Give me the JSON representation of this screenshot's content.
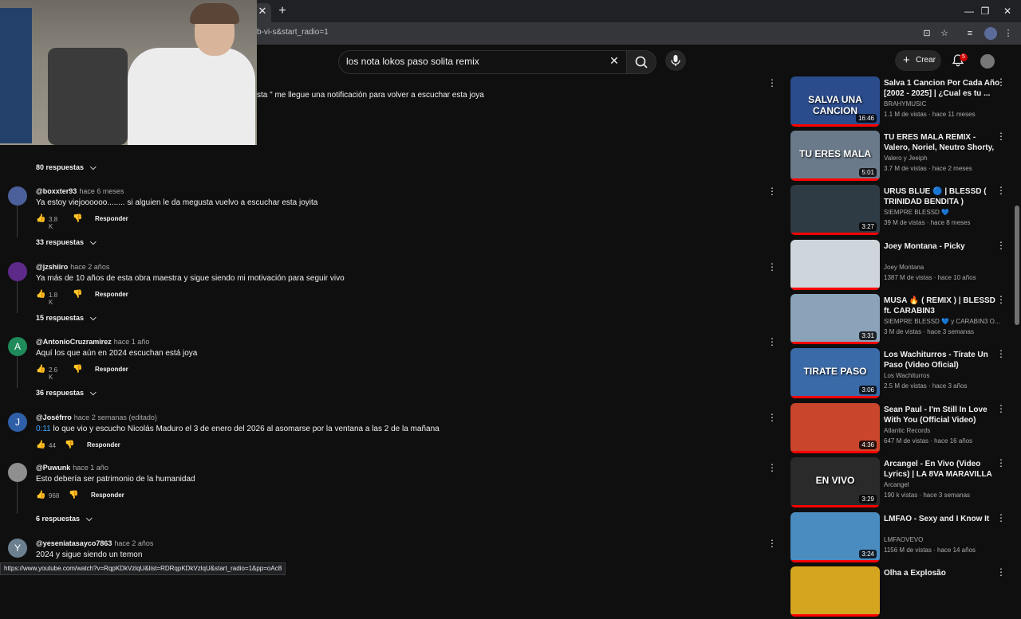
{
  "browser": {
    "url": "b-vi-s&start_radio=1",
    "status_url": "https://www.youtube.com/watch?v=RqpKDkVzlqU&list=RDRqpKDkVzlqU&start_radio=1&pp=oAc8"
  },
  "header": {
    "search_value": "los nota lokos paso solita remix",
    "create_label": "Crear",
    "notification_count": "5"
  },
  "comments": [
    {
      "author": "",
      "time": "",
      "text": "sta \" me llegue una notificación para volver a escuchar esta joya",
      "likes": "",
      "replies": "80 respuestas"
    },
    {
      "author": "@boxxter93",
      "time": "hace 6 meses",
      "text": "Ya estoy viejoooooo........ si alguien le da megusta vuelvo a escuchar esta joyita",
      "likes": "3.8 K",
      "replies": "33 respuestas"
    },
    {
      "author": "@jzshiiro",
      "time": "hace 2 años",
      "text": "Ya más de 10 años de esta obra maestra y sigue siendo mi motivación para seguir vivo",
      "likes": "1.8 K",
      "replies": "15 respuestas"
    },
    {
      "author": "@AntonioCruzramirez",
      "time": "hace 1 año",
      "text": "Aquí los que aún en 2024 escuchan está joya",
      "likes": "2.6 K",
      "replies": "36 respuestas",
      "avatar_letter": "A"
    },
    {
      "author": "@Joséfrro",
      "time": "hace 2 semanas (editado)",
      "timestamp_link": "0:11",
      "text": " lo que vio y escucho Nicolás Maduro el 3 de enero del 2026 al asomarse por la ventana a las 2 de la mañana",
      "likes": "44",
      "replies": "",
      "avatar_letter": "J"
    },
    {
      "author": "@Puwunk",
      "time": "hace 1 año",
      "text": "Esto debería ser patrimonio de la humanidad",
      "likes": "968",
      "replies": "6 respuestas"
    },
    {
      "author": "@yeseniatasayco7863",
      "time": "hace 2 años",
      "text": "2024 y sigue siendo un temon",
      "likes": "",
      "replies": "",
      "avatar_letter": "Y"
    }
  ],
  "reply_label": "Responder",
  "related": [
    {
      "title": "Salva 1 Cancion Por Cada Año [2002 - 2025] | ¿Cual es tu ...",
      "channel": "BRAHYMUSIC",
      "meta": "1.1 M de vistas · hace 11 meses",
      "duration": "16:46",
      "thumb_text": "SALVA UNA CANCION",
      "color": "#2b4c8c"
    },
    {
      "title": "TU ERES MALA REMIX - Valero, Noriel, Neutro Shorty, Jeeiph, ...",
      "channel": "Valero  y Jeeiph",
      "meta": "3.7 M de vistas · hace 2 meses",
      "duration": "5:01",
      "thumb_text": "TU ERES MALA",
      "color": "#6a7a8a"
    },
    {
      "title": "URUS BLUE  🔵  | BLESSD ( TRINIDAD BENDITA )",
      "channel": "SIEMPRE BLESSD 💙",
      "meta": "39 M de vistas · hace 8 meses",
      "duration": "3:27",
      "thumb_text": "",
      "color": "#2f3b44"
    },
    {
      "title": "Joey Montana - Picky",
      "channel": "Joey Montana",
      "meta": "1387 M de vistas · hace 10 años",
      "duration": "",
      "thumb_text": "",
      "color": "#cfd6db"
    },
    {
      "title": "MUSA 🔥 ( REMIX ) | BLESSD ft. CARABIN3",
      "channel": "SIEMPRE BLESSD 💙  y CARABIN3 O...",
      "meta": "3 M de vistas · hace 3 semanas",
      "duration": "3:31",
      "thumb_text": "",
      "color": "#8aa3b8"
    },
    {
      "title": "Los Wachiturros - Tírate Un Paso (Video Oficial)",
      "channel": "Los Wachiturros",
      "meta": "2.5 M de vistas · hace 3 años",
      "duration": "3:06",
      "thumb_text": "TIRATE PASO",
      "color": "#3b6aa8"
    },
    {
      "title": "Sean Paul - I'm Still In Love With You (Official Video)",
      "channel": "Atlantic Records",
      "meta": "647 M de vistas · hace 16 años",
      "duration": "4:36",
      "thumb_text": "",
      "color": "#c9452b"
    },
    {
      "title": "Arcangel - En Vivo (Video Lyrics) | LA 8VA MARAVILLA",
      "channel": "Arcangel",
      "meta": "190 k vistas · hace 3 semanas",
      "duration": "3:29",
      "thumb_text": "EN VIVO",
      "color": "#2a2a2a"
    },
    {
      "title": "LMFAO - Sexy and I Know It",
      "channel": "LMFAOVEVO",
      "meta": "1156 M de vistas · hace 14 años",
      "duration": "3:24",
      "thumb_text": "",
      "color": "#4a8cc0"
    },
    {
      "title": "Olha a Explosão",
      "channel": "",
      "meta": "",
      "duration": "",
      "thumb_text": "",
      "color": "#d6a51f"
    }
  ]
}
